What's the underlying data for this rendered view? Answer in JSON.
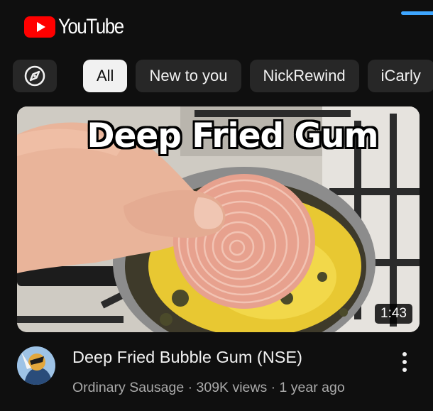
{
  "header": {
    "logo_text": "YouTube",
    "logo_icon": "youtube-play-icon"
  },
  "chips": [
    {
      "icon": "compass-icon",
      "label": ""
    },
    {
      "label": "All",
      "active": true
    },
    {
      "label": "New to you",
      "active": false
    },
    {
      "label": "NickRewind",
      "active": false
    },
    {
      "label": "iCarly",
      "active": false
    }
  ],
  "video": {
    "thumbnail_text": "Deep Fried Gum",
    "duration": "1:43",
    "title": "Deep Fried Bubble Gum (NSE)",
    "channel": "Ordinary Sausage",
    "views": "309K views",
    "age": "1 year ago",
    "meta_line": "Ordinary Sausage · 309K views · 1 year ago",
    "more_icon": "more-vert-icon"
  },
  "colors": {
    "background": "#0f0f0f",
    "accent": "#3ea6ff",
    "brand_red": "#ff0000",
    "chip_bg": "#272727",
    "chip_active_bg": "#f1f1f1",
    "secondary_text": "#aaaaaa"
  }
}
